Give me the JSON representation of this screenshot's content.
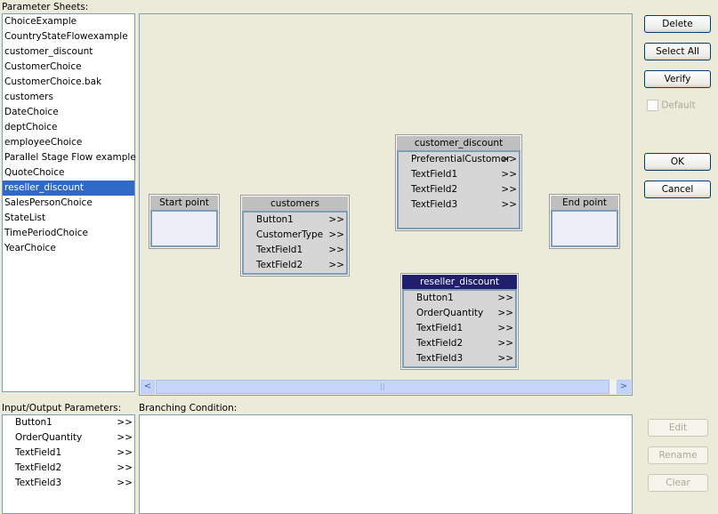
{
  "labels": {
    "parameter_sheets": "Parameter Sheets:",
    "io_params": "Input/Output Parameters:",
    "branching": "Branching Condition:"
  },
  "sheets": [
    "ChoiceExample",
    "CountryStateFlowexample",
    "customer_discount",
    "CustomerChoice",
    "CustomerChoice.bak",
    "customers",
    "DateChoice",
    "deptChoice",
    "employeeChoice",
    "Parallel Stage Flow example",
    "QuoteChoice",
    "reseller_discount",
    "SalesPersonChoice",
    "StateList",
    "TimePeriodChoice",
    "YearChoice"
  ],
  "selected_sheet": "reseller_discount",
  "nodes": {
    "start": {
      "title": "Start point"
    },
    "end": {
      "title": "End point"
    },
    "customers": {
      "title": "customers",
      "fields": [
        "Button1",
        "CustomerType",
        "TextField1",
        "TextField2"
      ]
    },
    "customer_discount": {
      "title": "customer_discount",
      "fields": [
        "PreferentialCustomer",
        "TextField1",
        "TextField2",
        "TextField3"
      ]
    },
    "reseller_discount": {
      "title": "reseller_discount",
      "fields": [
        "Button1",
        "OrderQuantity",
        "TextField1",
        "TextField2",
        "TextField3"
      ]
    }
  },
  "arrow": ">>",
  "io_params": [
    "Button1",
    "OrderQuantity",
    "TextField1",
    "TextField2",
    "TextField3"
  ],
  "branching_condition": "",
  "buttons": {
    "delete": "Delete",
    "select_all": "Select All",
    "verify": "Verify",
    "default": "Default",
    "ok": "OK",
    "cancel": "Cancel",
    "edit": "Edit",
    "rename": "Rename",
    "clear": "Clear"
  },
  "scroll": {
    "left": "<",
    "right": ">",
    "grip": "||"
  }
}
